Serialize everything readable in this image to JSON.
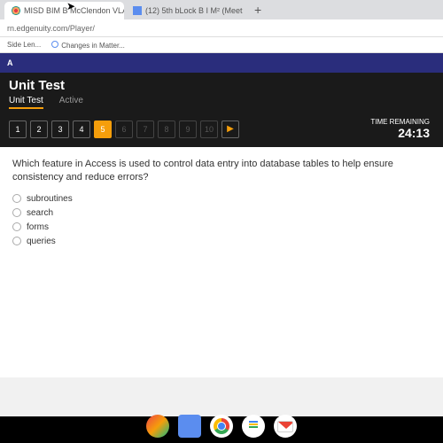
{
  "tabs": [
    {
      "label": "MISD BIM B McClendon VLA - E",
      "icon": "x"
    },
    {
      "label": "(12) 5th bLock B I M² (Meet",
      "icon": "t"
    }
  ],
  "urlbar": "rn.edgenuity.com/Player/",
  "bookmarks": [
    {
      "label": "Side Len..."
    },
    {
      "label": "Changes in Matter..."
    }
  ],
  "blueband": "A",
  "header": {
    "title": "Unit Test",
    "sub_left": "Unit Test",
    "sub_right": "Active"
  },
  "questions": {
    "nums": [
      "1",
      "2",
      "3",
      "4",
      "5",
      "6",
      "7",
      "8",
      "9",
      "10"
    ],
    "current_index": 4
  },
  "timer": {
    "label": "TIME REMAINING",
    "value": "24:13"
  },
  "question": {
    "text": "Which feature in Access is used to control data entry into database tables to help ensure consistency and reduce errors?",
    "options": [
      "subroutines",
      "search",
      "forms",
      "queries"
    ]
  }
}
